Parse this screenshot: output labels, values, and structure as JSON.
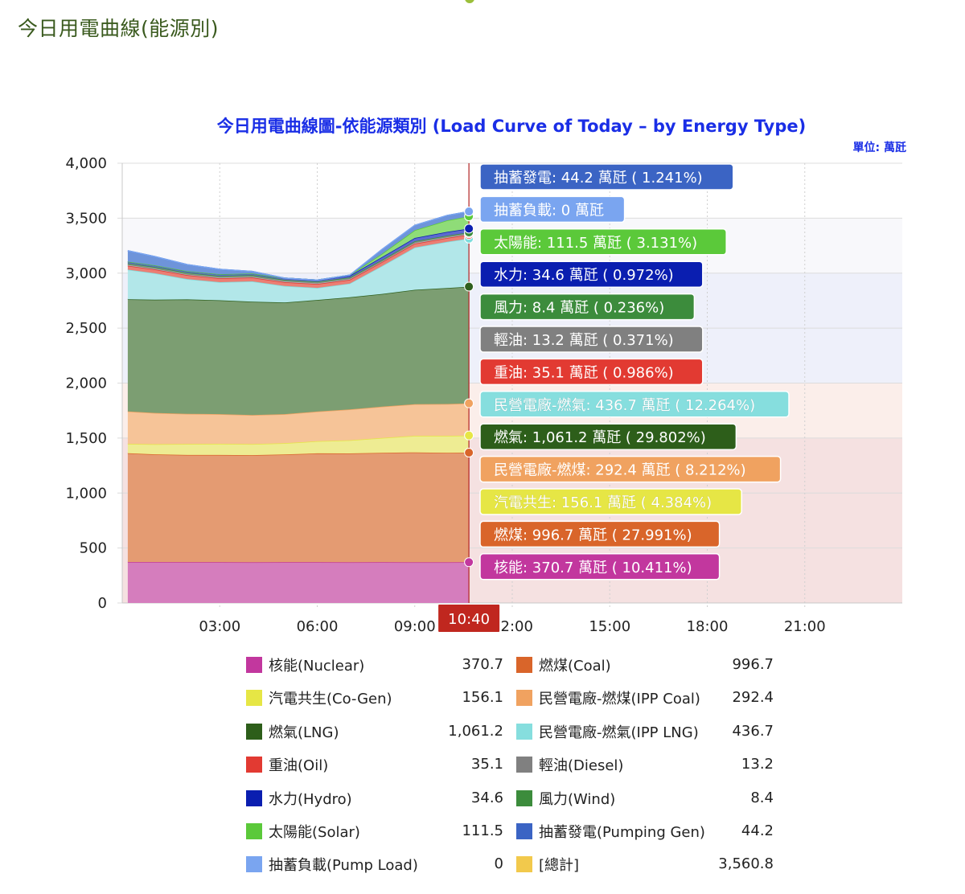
{
  "page": {
    "heading": "今日用電曲線(能源別)"
  },
  "chart_data": {
    "type": "area",
    "title": "今日用電曲線圖-依能源類別 (Load Curve of Today – by Energy Type)",
    "unit_label": "單位: 萬瓩",
    "ylim": [
      0,
      4000
    ],
    "y_ticks": [
      "0",
      "500",
      "1,000",
      "1,500",
      "2,000",
      "2,500",
      "3,000",
      "3,500",
      "4,000"
    ],
    "x_range_hours": [
      0,
      24
    ],
    "x_ticks": [
      "03:00",
      "06:00",
      "09:00",
      "12:00",
      "15:00",
      "18:00",
      "21:00"
    ],
    "x_tick_hours": [
      3,
      6,
      9,
      12,
      15,
      18,
      21
    ],
    "grid": true,
    "current_time": "10:40",
    "current_hour": 10.667,
    "time_hours": [
      0.17,
      1,
      2,
      3,
      4,
      5,
      6,
      7,
      8,
      9,
      10,
      10.67
    ],
    "background_bands": [
      {
        "from": 0,
        "to": 1500,
        "color": "#f5e1e1"
      },
      {
        "from": 1500,
        "to": 2000,
        "color": "#fbeeea"
      },
      {
        "from": 2000,
        "to": 3000,
        "color": "#eef0fa"
      },
      {
        "from": 3000,
        "to": 3500,
        "color": "#f8f8fb"
      }
    ],
    "series": [
      {
        "name": "核能",
        "color": "#c2379e",
        "fill": "#d57dbd",
        "values": [
          372,
          372,
          371,
          371,
          370,
          371,
          371,
          370,
          371,
          370,
          370,
          370.7
        ],
        "label": "核能: 370.7 萬瓩 ( 10.411%)"
      },
      {
        "name": "燃煤",
        "color": "#d9652a",
        "fill": "#e49b72",
        "values": [
          990,
          980,
          975,
          975,
          975,
          980,
          990,
          990,
          995,
          1000,
          995,
          996.7
        ],
        "label": "燃煤: 996.7 萬瓩 ( 27.991%)"
      },
      {
        "name": "汽電共生",
        "color": "#e6e645",
        "fill": "#eeec93",
        "values": [
          85,
          92,
          100,
          102,
          100,
          102,
          110,
          120,
          135,
          150,
          155,
          156.1
        ],
        "label": "汽電共生: 156.1 萬瓩 ( 4.384%)"
      },
      {
        "name": "民營電廠-燃煤",
        "color": "#f0a260",
        "fill": "#f6c498",
        "values": [
          295,
          285,
          275,
          270,
          265,
          265,
          270,
          280,
          285,
          288,
          290,
          292.4
        ],
        "label": "民營電廠-燃煤: 292.4 萬瓩 ( 8.212%)"
      },
      {
        "name": "燃氣",
        "color": "#2f5f1d",
        "fill": "#7c9e72",
        "values": [
          1020,
          1030,
          1040,
          1035,
          1030,
          1015,
          1015,
          1020,
          1025,
          1040,
          1055,
          1061.2
        ],
        "label": "燃氣: 1,061.2 萬瓩 ( 29.802%)"
      },
      {
        "name": "民營電廠-燃氣",
        "color": "#7fdede",
        "fill": "#b2e7e9",
        "values": [
          270,
          240,
          185,
          165,
          185,
          150,
          110,
          125,
          255,
          385,
          420,
          436.7
        ],
        "label": "民營電廠-燃氣: 436.7 萬瓩 ( 12.264%)"
      },
      {
        "name": "重油",
        "color": "#e23a32",
        "fill": "#eb7e74",
        "values": [
          35,
          35,
          35,
          35,
          35,
          35,
          35,
          35,
          35,
          35,
          35,
          35.1
        ],
        "label": "重油: 35.1 萬瓩 ( 0.986%)"
      },
      {
        "name": "輕油",
        "color": "#7f7f7f",
        "fill": "#a9a9a9",
        "values": [
          12,
          12,
          12,
          12,
          12,
          12,
          12,
          12,
          12,
          13,
          13,
          13.2
        ],
        "label": "輕油: 13.2 萬瓩 ( 0.371%)"
      },
      {
        "name": "風力",
        "color": "#3c8c3c",
        "fill": "#7fb27f",
        "values": [
          10,
          10,
          10,
          10,
          9,
          9,
          9,
          9,
          9,
          9,
          8.4,
          8.4
        ],
        "label": "風力: 8.4 萬瓩 ( 0.236%)"
      },
      {
        "name": "水力",
        "color": "#0a1eb0",
        "fill": "#5c6ad0",
        "values": [
          15,
          15,
          15,
          15,
          15,
          15,
          15,
          15,
          25,
          30,
          34,
          34.6
        ],
        "label": "水力: 34.6 萬瓩 ( 0.972%)"
      },
      {
        "name": "太陽能",
        "color": "#5bc93a",
        "fill": "#8fdc78",
        "values": [
          0,
          0,
          0,
          0,
          0,
          0,
          0,
          5,
          30,
          70,
          105,
          111.5
        ],
        "label": "太陽能: 111.5 萬瓩 ( 3.131%)"
      },
      {
        "name": "抽蓄發電",
        "color": "#3b6cc7",
        "fill": "#6e94da",
        "values": [
          100,
          80,
          60,
          45,
          20,
          0,
          0,
          0,
          40,
          45,
          44,
          44.2
        ],
        "label": "抽蓄發電: 44.2 萬瓩 ( 1.241%)"
      },
      {
        "name": "抽蓄負載",
        "color": "#7aa5f0",
        "fill": "#a6c2f5",
        "values": [
          0,
          0,
          0,
          0,
          0,
          0,
          0,
          0,
          0,
          0,
          0,
          0
        ],
        "label": "抽蓄負載: 0 萬瓩"
      }
    ],
    "tooltip_order": [
      "抽蓄發電",
      "抽蓄負載",
      "太陽能",
      "水力",
      "風力",
      "輕油",
      "重油",
      "民營電廠-燃氣",
      "燃氣",
      "民營電廠-燃煤",
      "汽電共生",
      "燃煤",
      "核能"
    ],
    "tooltip_colors": {
      "抽蓄發電": "#3b64c4",
      "抽蓄負載": "#7aa5f0",
      "太陽能": "#5bc93a",
      "水力": "#0a1eb0",
      "風力": "#3c8c3c",
      "輕油": "#808080",
      "重油": "#e23a32",
      "民營電廠-燃氣": "#86dede",
      "燃氣": "#2d5e1a",
      "民營電廠-燃煤": "#f0a260",
      "汽電共生": "#e6e645",
      "燃煤": "#d9652a",
      "核能": "#c2379e"
    }
  },
  "legend": [
    {
      "label": "核能(Nuclear)",
      "value": "370.7",
      "color": "#c2379e"
    },
    {
      "label": "燃煤(Coal)",
      "value": "996.7",
      "color": "#d9652a"
    },
    {
      "label": "汽電共生(Co-Gen)",
      "value": "156.1",
      "color": "#e6e645"
    },
    {
      "label": "民營電廠-燃煤(IPP Coal)",
      "value": "292.4",
      "color": "#f0a260"
    },
    {
      "label": "燃氣(LNG)",
      "value": "1,061.2",
      "color": "#2d5e1a"
    },
    {
      "label": "民營電廠-燃氣(IPP LNG)",
      "value": "436.7",
      "color": "#86dede"
    },
    {
      "label": "重油(Oil)",
      "value": "35.1",
      "color": "#e23a32"
    },
    {
      "label": "輕油(Diesel)",
      "value": "13.2",
      "color": "#808080"
    },
    {
      "label": "水力(Hydro)",
      "value": "34.6",
      "color": "#0a1eb0"
    },
    {
      "label": "風力(Wind)",
      "value": "8.4",
      "color": "#3c8c3c"
    },
    {
      "label": "太陽能(Solar)",
      "value": "111.5",
      "color": "#5bc93a"
    },
    {
      "label": "抽蓄發電(Pumping Gen)",
      "value": "44.2",
      "color": "#3b64c4"
    },
    {
      "label": "抽蓄負載(Pump Load)",
      "value": "0",
      "color": "#7aa5f0"
    },
    {
      "label": "[總計]",
      "value": "3,560.8",
      "color": "#f2c94c"
    }
  ]
}
